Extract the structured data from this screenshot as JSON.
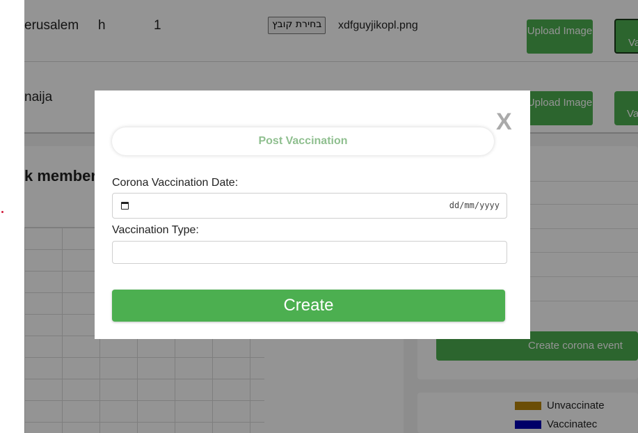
{
  "table": {
    "rows": [
      {
        "city": "erusalem",
        "name": "h",
        "count": "1",
        "file_button": "בחירת קובץ",
        "file_name": "xdfguyjikopl.png",
        "upload_label": "Upload Image",
        "action_label_partial": "Va"
      },
      {
        "city": "naija",
        "upload_label": "Upload Image",
        "action_label_partial": "Va"
      }
    ]
  },
  "members_panel": {
    "title_partial": "k member"
  },
  "right_panel": {
    "create_event_label": "Create corona event"
  },
  "legend": [
    {
      "label": "Unvaccinate",
      "color": "#b8860b"
    },
    {
      "label": "Vaccinatec",
      "color": "#0000b3"
    }
  ],
  "modal": {
    "close_label": "X",
    "title": "Post Vaccination",
    "date_label": "Corona Vaccination Date:",
    "date_placeholder": "dd/mm/yyyy",
    "type_label": "Vaccination Type:",
    "type_value": "",
    "create_label": "Create"
  },
  "colors": {
    "accent": "#4caf50",
    "title_text": "#8fbf8f",
    "close_x": "#aaaaaa"
  }
}
